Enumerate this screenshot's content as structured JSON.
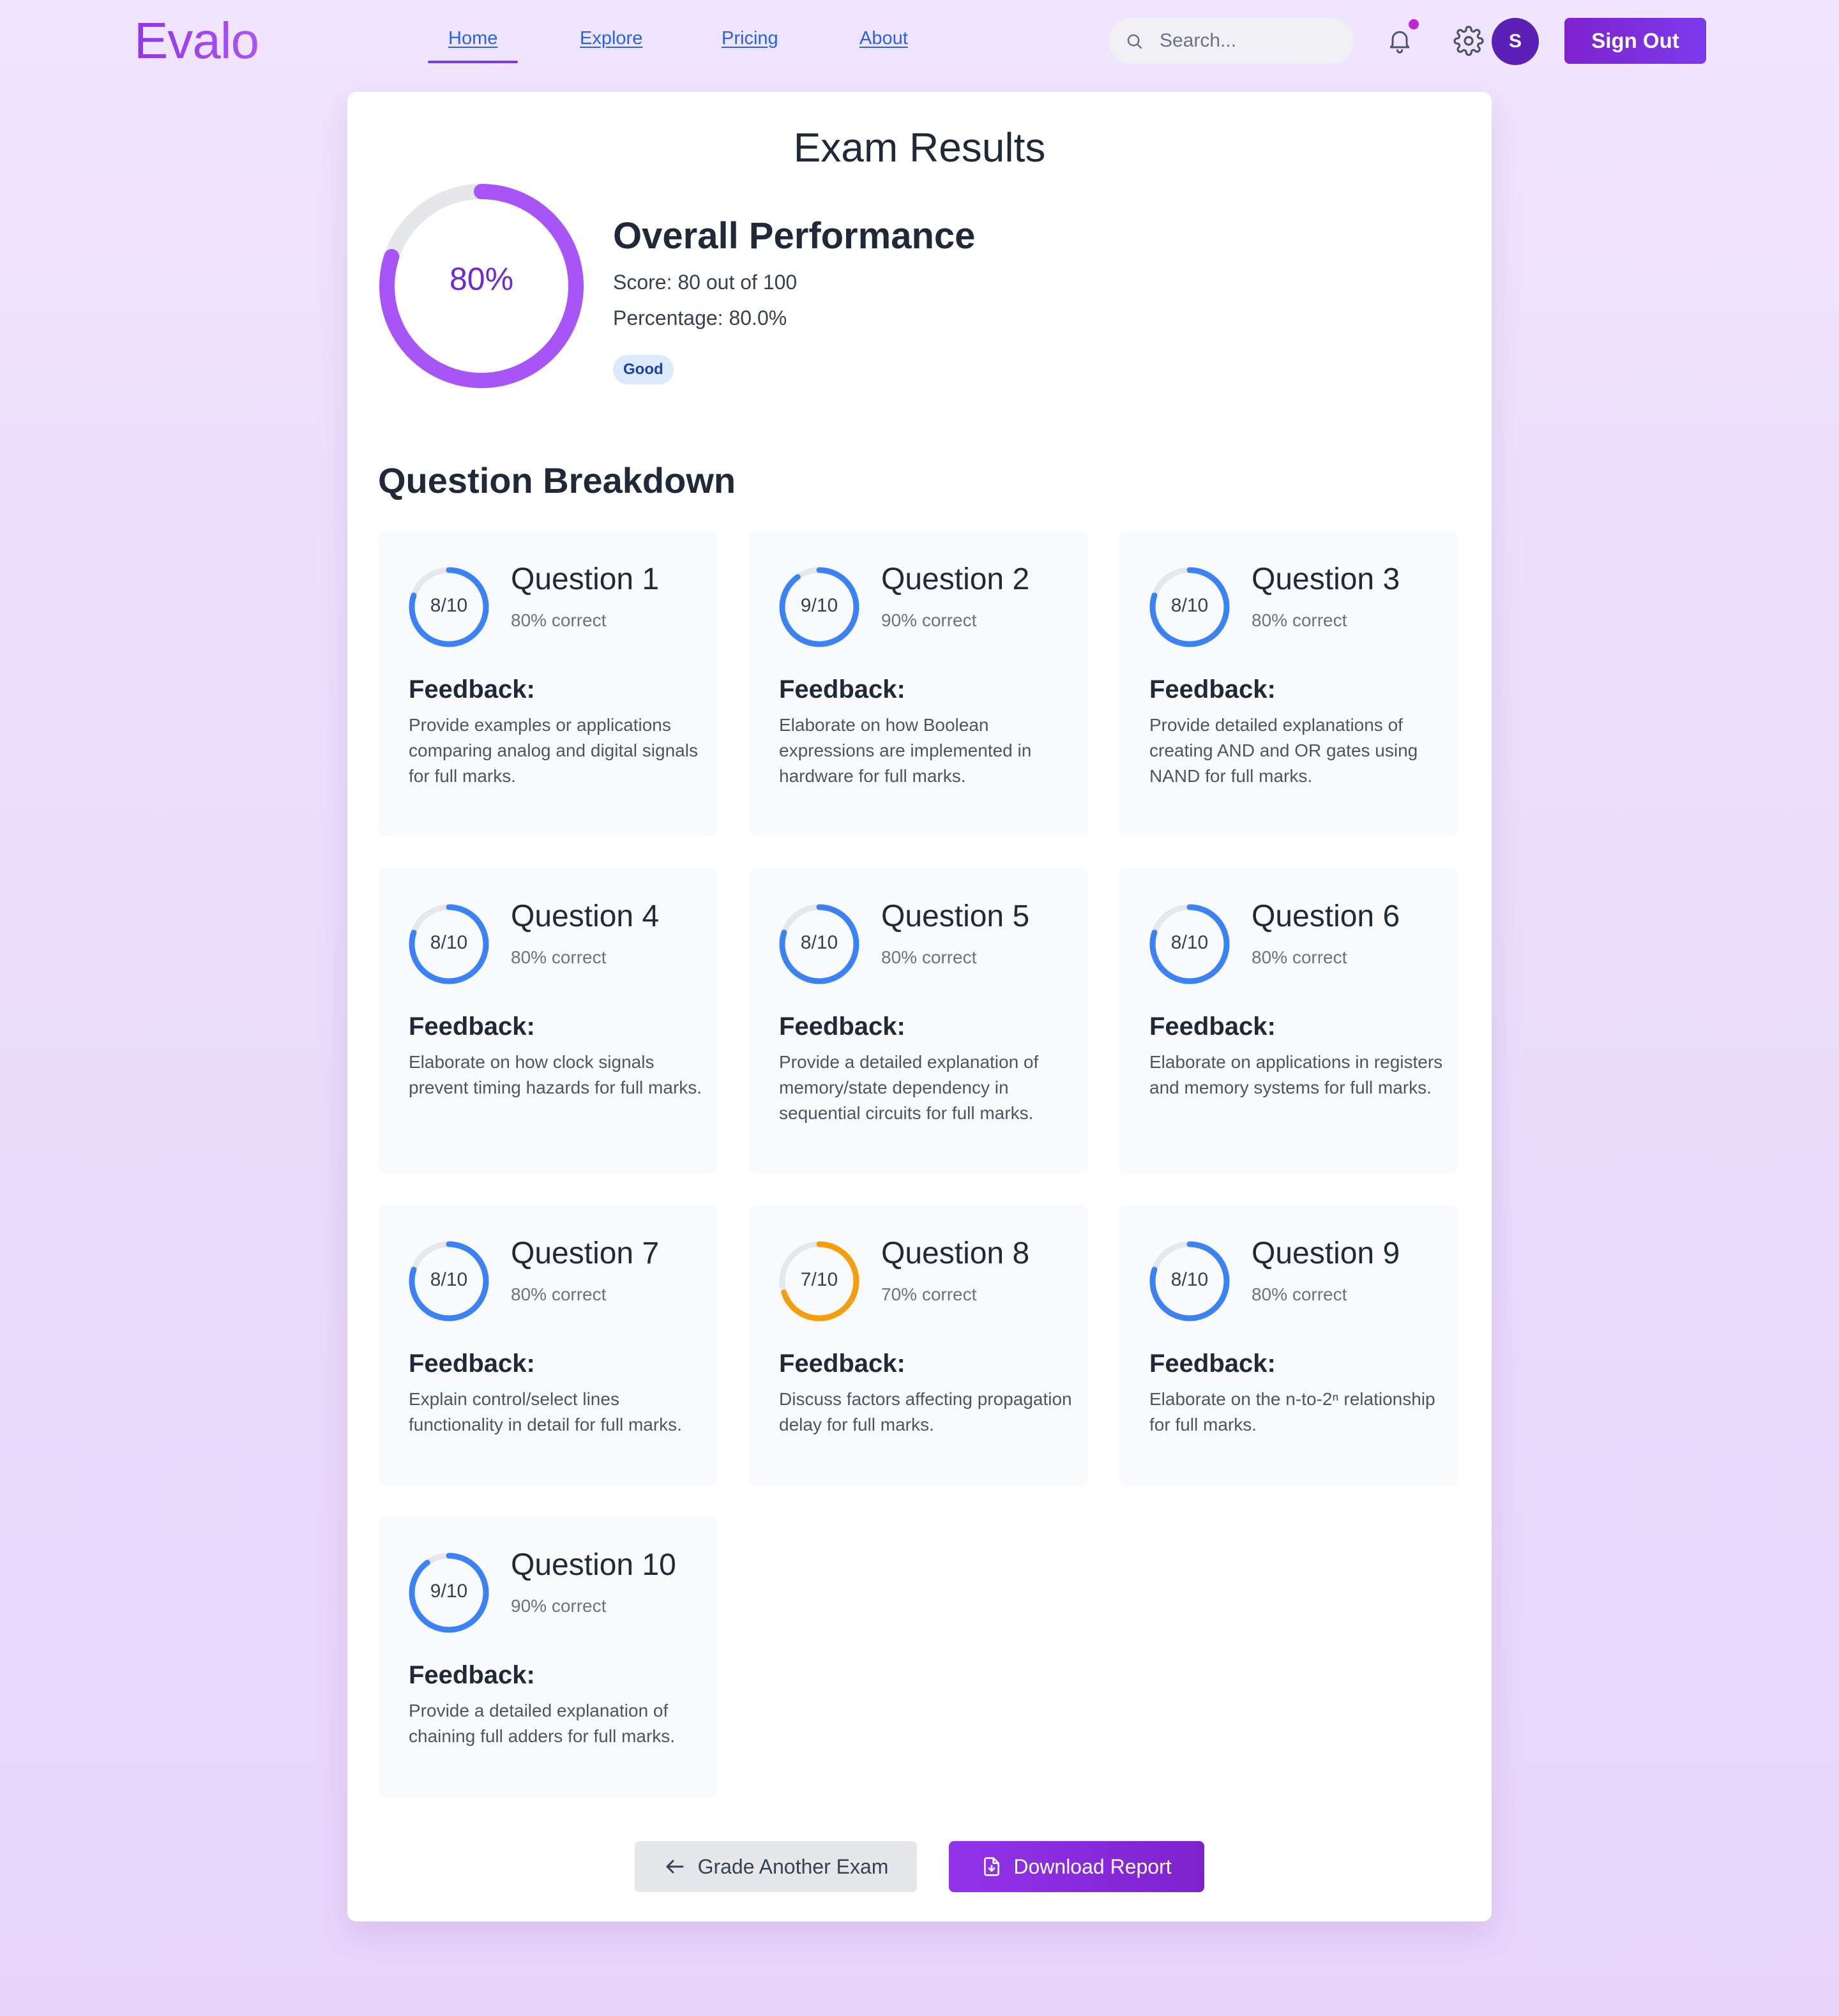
{
  "nav": {
    "logo": "Evalo",
    "links": [
      "Home",
      "Explore",
      "Pricing",
      "About"
    ],
    "active": "Home",
    "search_placeholder": "Search...",
    "avatar_initial": "S",
    "signout_label": "Sign Out",
    "icons": [
      "search-icon",
      "bell-icon",
      "gear-icon"
    ]
  },
  "results": {
    "title": "Exam Results",
    "overall": {
      "percent_label": "80%",
      "percent": 80,
      "title": "Overall Performance",
      "score_text": "Score: 80 out of 100",
      "percentage_text": "Percentage: 80.0%",
      "badge": "Good"
    },
    "breakdown_title": "Question Breakdown",
    "feedback_label": "Feedback:",
    "questions": [
      {
        "title": "Question 1",
        "score": "8/10",
        "percent": 80,
        "correct": "80% correct",
        "feedback": "Provide examples or applications comparing analog and digital signals for full marks."
      },
      {
        "title": "Question 2",
        "score": "9/10",
        "percent": 90,
        "correct": "90% correct",
        "feedback": "Elaborate on how Boolean expressions are implemented in hardware for full marks."
      },
      {
        "title": "Question 3",
        "score": "8/10",
        "percent": 80,
        "correct": "80% correct",
        "feedback": "Provide detailed explanations of creating AND and OR gates using NAND for full marks."
      },
      {
        "title": "Question 4",
        "score": "8/10",
        "percent": 80,
        "correct": "80% correct",
        "feedback": "Elaborate on how clock signals prevent timing hazards for full marks."
      },
      {
        "title": "Question 5",
        "score": "8/10",
        "percent": 80,
        "correct": "80% correct",
        "feedback": "Provide a detailed explanation of memory/state dependency in sequential circuits for full marks."
      },
      {
        "title": "Question 6",
        "score": "8/10",
        "percent": 80,
        "correct": "80% correct",
        "feedback": "Elaborate on applications in registers and memory systems for full marks."
      },
      {
        "title": "Question 7",
        "score": "8/10",
        "percent": 80,
        "correct": "80% correct",
        "feedback": "Explain control/select lines functionality in detail for full marks."
      },
      {
        "title": "Question 8",
        "score": "7/10",
        "percent": 70,
        "correct": "70% correct",
        "feedback": "Discuss factors affecting propagation delay for full marks."
      },
      {
        "title": "Question 9",
        "score": "8/10",
        "percent": 80,
        "correct": "80% correct",
        "feedback": "Elaborate on the n-to-2ⁿ relationship for full marks."
      },
      {
        "title": "Question 10",
        "score": "9/10",
        "percent": 90,
        "correct": "90% correct",
        "feedback": "Provide a detailed explanation of chaining full adders for full marks."
      }
    ],
    "actions": {
      "back_label": "Grade Another Exam",
      "download_label": "Download Report"
    }
  },
  "colors": {
    "brand": "#9333ea",
    "ring_high": "#3b82f6",
    "ring_mid": "#f59e0b",
    "ring_track": "#e5e7eb",
    "overall_ring": "#a855f7"
  }
}
